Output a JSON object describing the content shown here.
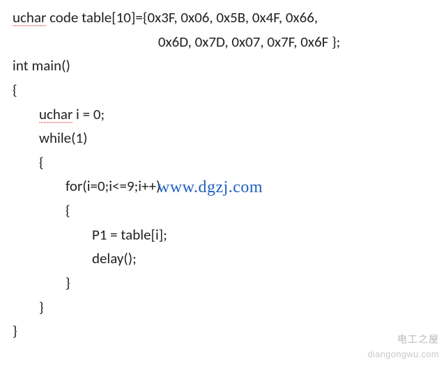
{
  "code": {
    "l1a": "uchar",
    "l1b": " code table[10]={0x3F, 0x06, 0x5B, 0x4F, 0x66,",
    "l2": "                                            0x6D, 0x7D, 0x07, 0x7F, 0x6F };",
    "l3": "int main()",
    "l4": "{",
    "l5a": "        ",
    "l5b": "uchar",
    "l5c": " i = 0;",
    "l6": "        while(1)",
    "l7": "        {",
    "l8": "                for(i=0;i<=9;i++)",
    "l9": "                {",
    "l10": "                        P1 = table[i];",
    "l11": "                        delay();",
    "l12": "                }",
    "l13": "        }",
    "l14": "}"
  },
  "watermarks": {
    "url": "www.dgzj.com",
    "logo": "电工之屋",
    "domain": "diangongwu.com"
  }
}
